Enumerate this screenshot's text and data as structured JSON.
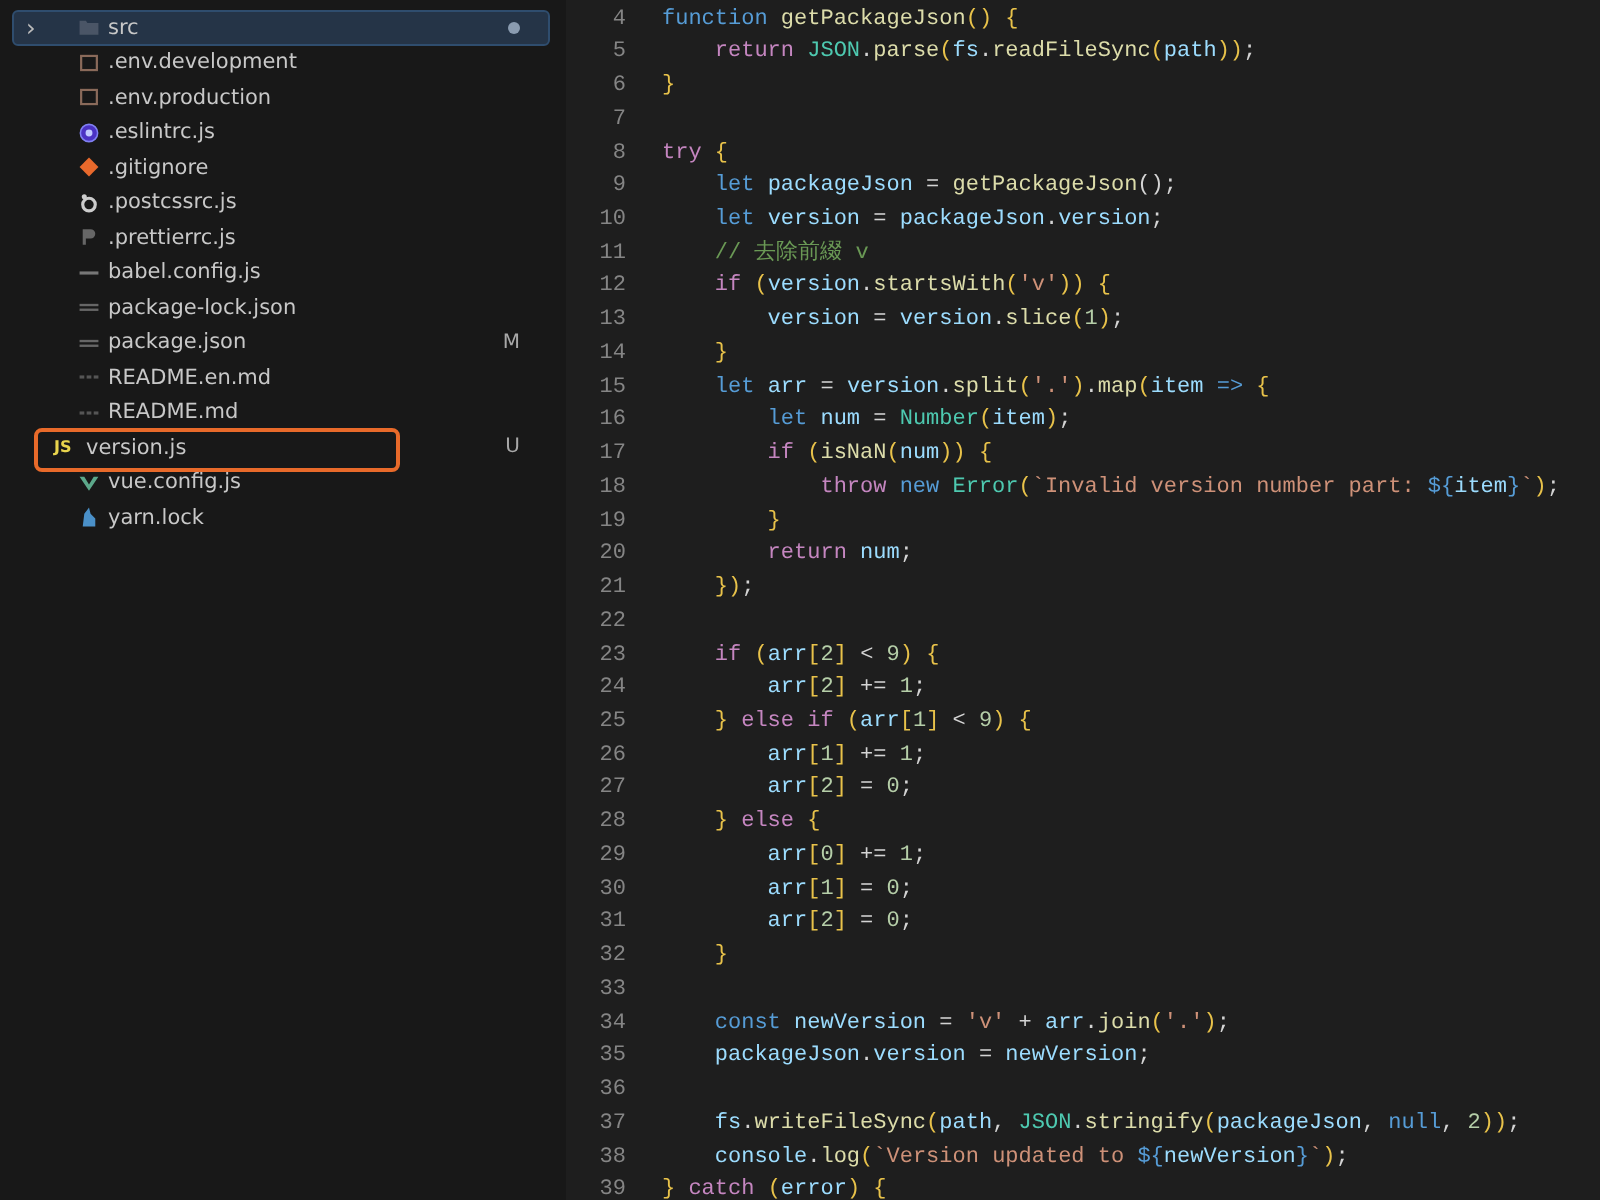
{
  "sidebar": {
    "items": [
      {
        "name": "src",
        "kind": "folder",
        "chevron": "›",
        "unsaved": true,
        "selected": true,
        "outlined": false
      },
      {
        "name": ".env.development",
        "kind": "env",
        "unsaved": false,
        "selected": false,
        "outlined": false
      },
      {
        "name": ".env.production",
        "kind": "env",
        "unsaved": false,
        "selected": false,
        "outlined": false
      },
      {
        "name": ".eslintrc.js",
        "kind": "eslint",
        "unsaved": false,
        "selected": false,
        "outlined": false
      },
      {
        "name": ".gitignore",
        "kind": "git",
        "unsaved": false,
        "selected": false,
        "outlined": false
      },
      {
        "name": ".postcssrc.js",
        "kind": "postcss",
        "unsaved": false,
        "selected": false,
        "outlined": false
      },
      {
        "name": ".prettierrc.js",
        "kind": "prettier",
        "unsaved": false,
        "selected": false,
        "outlined": false
      },
      {
        "name": "babel.config.js",
        "kind": "babel",
        "unsaved": false,
        "selected": false,
        "outlined": false
      },
      {
        "name": "package-lock.json",
        "kind": "json",
        "unsaved": false,
        "selected": false,
        "outlined": false
      },
      {
        "name": "package.json",
        "kind": "json",
        "badge": "M",
        "unsaved": false,
        "selected": false,
        "outlined": false
      },
      {
        "name": "README.en.md",
        "kind": "md",
        "unsaved": false,
        "selected": false,
        "outlined": false
      },
      {
        "name": "README.md",
        "kind": "md",
        "unsaved": false,
        "selected": false,
        "outlined": false
      },
      {
        "name": "version.js",
        "kind": "js",
        "icon_label": "JS",
        "badge": "U",
        "unsaved": false,
        "selected": false,
        "outlined": true
      },
      {
        "name": "vue.config.js",
        "kind": "vue",
        "unsaved": false,
        "selected": false,
        "outlined": false
      },
      {
        "name": "yarn.lock",
        "kind": "yarn",
        "unsaved": false,
        "selected": false,
        "outlined": false
      }
    ]
  },
  "editor": {
    "lines": [
      {
        "number": "4",
        "tokens": [
          {
            "kind": "kw",
            "text": "function "
          },
          {
            "kind": "fn",
            "text": "getPackageJson"
          },
          {
            "kind": "br",
            "text": "() {"
          }
        ]
      },
      {
        "number": "5",
        "tokens": [
          {
            "kind": "ctrl",
            "text": "    return "
          },
          {
            "kind": "cls",
            "text": "JSON"
          },
          {
            "kind": "p",
            "text": "."
          },
          {
            "kind": "fn",
            "text": "parse"
          },
          {
            "kind": "br",
            "text": "("
          },
          {
            "kind": "var",
            "text": "fs"
          },
          {
            "kind": "p",
            "text": "."
          },
          {
            "kind": "fn",
            "text": "readFileSync"
          },
          {
            "kind": "br",
            "text": "("
          },
          {
            "kind": "var",
            "text": "path"
          },
          {
            "kind": "br",
            "text": "))"
          },
          {
            "kind": "p",
            "text": ";"
          }
        ]
      },
      {
        "number": "6",
        "tokens": [
          {
            "kind": "br",
            "text": "}"
          }
        ]
      },
      {
        "number": "7"
      },
      {
        "number": "8",
        "tokens": [
          {
            "kind": "ctrl",
            "text": "try "
          },
          {
            "kind": "br",
            "text": "{"
          }
        ]
      },
      {
        "number": "9",
        "tokens": [
          {
            "kind": "kw",
            "text": "    let "
          },
          {
            "kind": "var",
            "text": "packageJson"
          },
          {
            "kind": "p",
            "text": " = "
          },
          {
            "kind": "fn",
            "text": "getPackageJson"
          },
          {
            "kind": "p",
            "text": "();"
          }
        ]
      },
      {
        "number": "10",
        "tokens": [
          {
            "kind": "kw",
            "text": "    let "
          },
          {
            "kind": "var",
            "text": "version"
          },
          {
            "kind": "p",
            "text": " = "
          },
          {
            "kind": "var",
            "text": "packageJson"
          },
          {
            "kind": "p",
            "text": "."
          },
          {
            "kind": "var",
            "text": "version"
          },
          {
            "kind": "p",
            "text": ";"
          }
        ]
      },
      {
        "number": "11",
        "tokens": [
          {
            "kind": "cmt",
            "text": "    // 去除前綴 v"
          }
        ]
      },
      {
        "number": "12",
        "tokens": [
          {
            "kind": "ctrl",
            "text": "    if "
          },
          {
            "kind": "br",
            "text": "("
          },
          {
            "kind": "var",
            "text": "version"
          },
          {
            "kind": "p",
            "text": "."
          },
          {
            "kind": "fn",
            "text": "startsWith"
          },
          {
            "kind": "br",
            "text": "("
          },
          {
            "kind": "str",
            "text": "'v'"
          },
          {
            "kind": "br",
            "text": ")) {"
          }
        ]
      },
      {
        "number": "13",
        "tokens": [
          {
            "kind": "var",
            "text": "        version"
          },
          {
            "kind": "p",
            "text": " = "
          },
          {
            "kind": "var",
            "text": "version"
          },
          {
            "kind": "p",
            "text": "."
          },
          {
            "kind": "fn",
            "text": "slice"
          },
          {
            "kind": "br",
            "text": "("
          },
          {
            "kind": "num",
            "text": "1"
          },
          {
            "kind": "br",
            "text": ")"
          },
          {
            "kind": "p",
            "text": ";"
          }
        ]
      },
      {
        "number": "14",
        "tokens": [
          {
            "kind": "br",
            "text": "    }"
          }
        ]
      },
      {
        "number": "15",
        "tokens": [
          {
            "kind": "kw",
            "text": "    let "
          },
          {
            "kind": "var",
            "text": "arr"
          },
          {
            "kind": "p",
            "text": " = "
          },
          {
            "kind": "var",
            "text": "version"
          },
          {
            "kind": "p",
            "text": "."
          },
          {
            "kind": "fn",
            "text": "split"
          },
          {
            "kind": "br",
            "text": "("
          },
          {
            "kind": "str",
            "text": "'.'"
          },
          {
            "kind": "br",
            "text": ")"
          },
          {
            "kind": "p",
            "text": "."
          },
          {
            "kind": "fn",
            "text": "map"
          },
          {
            "kind": "br",
            "text": "("
          },
          {
            "kind": "var",
            "text": "item"
          },
          {
            "kind": "kw",
            "text": " => "
          },
          {
            "kind": "br",
            "text": "{"
          }
        ]
      },
      {
        "number": "16",
        "tokens": [
          {
            "kind": "kw",
            "text": "        let "
          },
          {
            "kind": "var",
            "text": "num"
          },
          {
            "kind": "p",
            "text": " = "
          },
          {
            "kind": "cls",
            "text": "Number"
          },
          {
            "kind": "br",
            "text": "("
          },
          {
            "kind": "var",
            "text": "item"
          },
          {
            "kind": "br",
            "text": ")"
          },
          {
            "kind": "p",
            "text": ";"
          }
        ]
      },
      {
        "number": "17",
        "tokens": [
          {
            "kind": "ctrl",
            "text": "        if "
          },
          {
            "kind": "br",
            "text": "("
          },
          {
            "kind": "fn",
            "text": "isNaN"
          },
          {
            "kind": "br",
            "text": "("
          },
          {
            "kind": "var",
            "text": "num"
          },
          {
            "kind": "br",
            "text": ")) {"
          }
        ]
      },
      {
        "number": "18",
        "tokens": [
          {
            "kind": "ctrl",
            "text": "            throw "
          },
          {
            "kind": "kw",
            "text": "new "
          },
          {
            "kind": "cls",
            "text": "Error"
          },
          {
            "kind": "br",
            "text": "("
          },
          {
            "kind": "str",
            "text": "`Invalid version number part: "
          },
          {
            "kind": "kw",
            "text": "${"
          },
          {
            "kind": "var",
            "text": "item"
          },
          {
            "kind": "kw",
            "text": "}"
          },
          {
            "kind": "str",
            "text": "`"
          },
          {
            "kind": "br",
            "text": ")"
          },
          {
            "kind": "p",
            "text": ";"
          }
        ]
      },
      {
        "number": "19",
        "tokens": [
          {
            "kind": "br",
            "text": "        }"
          }
        ]
      },
      {
        "number": "20",
        "tokens": [
          {
            "kind": "ctrl",
            "text": "        return "
          },
          {
            "kind": "var",
            "text": "num"
          },
          {
            "kind": "p",
            "text": ";"
          }
        ]
      },
      {
        "number": "21",
        "tokens": [
          {
            "kind": "br",
            "text": "    })"
          },
          {
            "kind": "p",
            "text": ";"
          }
        ]
      },
      {
        "number": "22"
      },
      {
        "number": "23",
        "tokens": [
          {
            "kind": "ctrl",
            "text": "    if "
          },
          {
            "kind": "br",
            "text": "("
          },
          {
            "kind": "var",
            "text": "arr"
          },
          {
            "kind": "br",
            "text": "["
          },
          {
            "kind": "num",
            "text": "2"
          },
          {
            "kind": "br",
            "text": "]"
          },
          {
            "kind": "p",
            "text": " < "
          },
          {
            "kind": "num",
            "text": "9"
          },
          {
            "kind": "br",
            "text": ") {"
          }
        ]
      },
      {
        "number": "24",
        "tokens": [
          {
            "kind": "var",
            "text": "        arr"
          },
          {
            "kind": "br",
            "text": "["
          },
          {
            "kind": "num",
            "text": "2"
          },
          {
            "kind": "br",
            "text": "]"
          },
          {
            "kind": "p",
            "text": " += "
          },
          {
            "kind": "num",
            "text": "1"
          },
          {
            "kind": "p",
            "text": ";"
          }
        ]
      },
      {
        "number": "25",
        "tokens": [
          {
            "kind": "br",
            "text": "    } "
          },
          {
            "kind": "ctrl",
            "text": "else if "
          },
          {
            "kind": "br",
            "text": "("
          },
          {
            "kind": "var",
            "text": "arr"
          },
          {
            "kind": "br",
            "text": "["
          },
          {
            "kind": "num",
            "text": "1"
          },
          {
            "kind": "br",
            "text": "]"
          },
          {
            "kind": "p",
            "text": " < "
          },
          {
            "kind": "num",
            "text": "9"
          },
          {
            "kind": "br",
            "text": ") {"
          }
        ]
      },
      {
        "number": "26",
        "tokens": [
          {
            "kind": "var",
            "text": "        arr"
          },
          {
            "kind": "br",
            "text": "["
          },
          {
            "kind": "num",
            "text": "1"
          },
          {
            "kind": "br",
            "text": "]"
          },
          {
            "kind": "p",
            "text": " += "
          },
          {
            "kind": "num",
            "text": "1"
          },
          {
            "kind": "p",
            "text": ";"
          }
        ]
      },
      {
        "number": "27",
        "tokens": [
          {
            "kind": "var",
            "text": "        arr"
          },
          {
            "kind": "br",
            "text": "["
          },
          {
            "kind": "num",
            "text": "2"
          },
          {
            "kind": "br",
            "text": "]"
          },
          {
            "kind": "p",
            "text": " = "
          },
          {
            "kind": "num",
            "text": "0"
          },
          {
            "kind": "p",
            "text": ";"
          }
        ]
      },
      {
        "number": "28",
        "tokens": [
          {
            "kind": "br",
            "text": "    } "
          },
          {
            "kind": "ctrl",
            "text": "else "
          },
          {
            "kind": "br",
            "text": "{"
          }
        ]
      },
      {
        "number": "29",
        "tokens": [
          {
            "kind": "var",
            "text": "        arr"
          },
          {
            "kind": "br",
            "text": "["
          },
          {
            "kind": "num",
            "text": "0"
          },
          {
            "kind": "br",
            "text": "]"
          },
          {
            "kind": "p",
            "text": " += "
          },
          {
            "kind": "num",
            "text": "1"
          },
          {
            "kind": "p",
            "text": ";"
          }
        ]
      },
      {
        "number": "30",
        "tokens": [
          {
            "kind": "var",
            "text": "        arr"
          },
          {
            "kind": "br",
            "text": "["
          },
          {
            "kind": "num",
            "text": "1"
          },
          {
            "kind": "br",
            "text": "]"
          },
          {
            "kind": "p",
            "text": " = "
          },
          {
            "kind": "num",
            "text": "0"
          },
          {
            "kind": "p",
            "text": ";"
          }
        ]
      },
      {
        "number": "31",
        "tokens": [
          {
            "kind": "var",
            "text": "        arr"
          },
          {
            "kind": "br",
            "text": "["
          },
          {
            "kind": "num",
            "text": "2"
          },
          {
            "kind": "br",
            "text": "]"
          },
          {
            "kind": "p",
            "text": " = "
          },
          {
            "kind": "num",
            "text": "0"
          },
          {
            "kind": "p",
            "text": ";"
          }
        ]
      },
      {
        "number": "32",
        "tokens": [
          {
            "kind": "br",
            "text": "    }"
          }
        ]
      },
      {
        "number": "33"
      },
      {
        "number": "34",
        "tokens": [
          {
            "kind": "kw",
            "text": "    const "
          },
          {
            "kind": "var",
            "text": "newVersion"
          },
          {
            "kind": "p",
            "text": " = "
          },
          {
            "kind": "str",
            "text": "'v'"
          },
          {
            "kind": "p",
            "text": " + "
          },
          {
            "kind": "var",
            "text": "arr"
          },
          {
            "kind": "p",
            "text": "."
          },
          {
            "kind": "fn",
            "text": "join"
          },
          {
            "kind": "br",
            "text": "("
          },
          {
            "kind": "str",
            "text": "'.'"
          },
          {
            "kind": "br",
            "text": ")"
          },
          {
            "kind": "p",
            "text": ";"
          }
        ]
      },
      {
        "number": "35",
        "tokens": [
          {
            "kind": "var",
            "text": "    packageJson"
          },
          {
            "kind": "p",
            "text": "."
          },
          {
            "kind": "var",
            "text": "version"
          },
          {
            "kind": "p",
            "text": " = "
          },
          {
            "kind": "var",
            "text": "newVersion"
          },
          {
            "kind": "p",
            "text": ";"
          }
        ]
      },
      {
        "number": "36"
      },
      {
        "number": "37",
        "tokens": [
          {
            "kind": "var",
            "text": "    fs"
          },
          {
            "kind": "p",
            "text": "."
          },
          {
            "kind": "fn",
            "text": "writeFileSync"
          },
          {
            "kind": "br",
            "text": "("
          },
          {
            "kind": "var",
            "text": "path"
          },
          {
            "kind": "p",
            "text": ", "
          },
          {
            "kind": "cls",
            "text": "JSON"
          },
          {
            "kind": "p",
            "text": "."
          },
          {
            "kind": "fn",
            "text": "stringify"
          },
          {
            "kind": "br",
            "text": "("
          },
          {
            "kind": "var",
            "text": "packageJson"
          },
          {
            "kind": "p",
            "text": ", "
          },
          {
            "kind": "kw",
            "text": "null"
          },
          {
            "kind": "p",
            "text": ", "
          },
          {
            "kind": "num",
            "text": "2"
          },
          {
            "kind": "br",
            "text": "))"
          },
          {
            "kind": "p",
            "text": ";"
          }
        ]
      },
      {
        "number": "38",
        "tokens": [
          {
            "kind": "var",
            "text": "    console"
          },
          {
            "kind": "p",
            "text": "."
          },
          {
            "kind": "fn",
            "text": "log"
          },
          {
            "kind": "br",
            "text": "("
          },
          {
            "kind": "str",
            "text": "`Version updated to "
          },
          {
            "kind": "kw",
            "text": "${"
          },
          {
            "kind": "var",
            "text": "newVersion"
          },
          {
            "kind": "kw",
            "text": "}"
          },
          {
            "kind": "str",
            "text": "`"
          },
          {
            "kind": "br",
            "text": ")"
          },
          {
            "kind": "p",
            "text": ";"
          }
        ]
      },
      {
        "number": "39",
        "tokens": [
          {
            "kind": "br",
            "text": "} "
          },
          {
            "kind": "ctrl",
            "text": "catch "
          },
          {
            "kind": "br",
            "text": "("
          },
          {
            "kind": "var",
            "text": "error"
          },
          {
            "kind": "br",
            "text": ") {"
          }
        ]
      }
    ]
  }
}
